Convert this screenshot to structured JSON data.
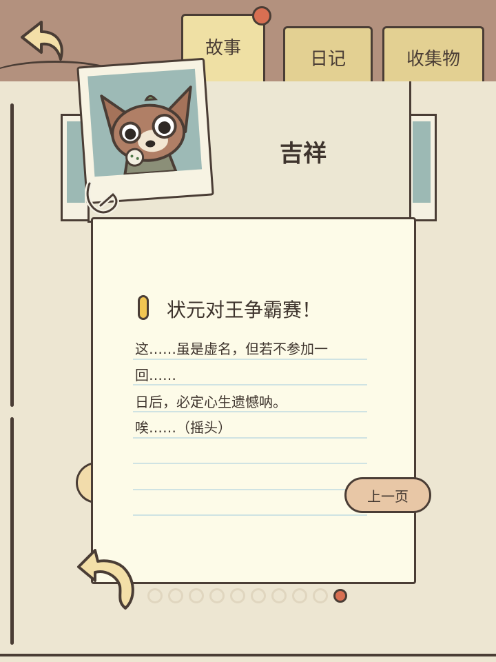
{
  "tabs": [
    {
      "label": "故事",
      "active": true
    },
    {
      "label": "日记",
      "active": false
    },
    {
      "label": "收集物",
      "active": false
    }
  ],
  "character": {
    "name": "吉祥"
  },
  "note": {
    "title": "状元对王争霸赛！",
    "lines": [
      "这……虽是虚名，但若不参加一",
      "回……",
      "日后，必定心生遗憾呐。",
      "唉……（摇头）"
    ]
  },
  "buttons": {
    "prev_label": "上一页"
  },
  "pagination": {
    "total": 10,
    "current": 10
  },
  "colors": {
    "background": "#b3917e",
    "paper": "#fdfbe8",
    "tab_active": "#efe0a4",
    "tab_inactive": "#e3d092",
    "accent_red": "#d86f52",
    "outline": "#4a3d35",
    "button": "#e8c7a6",
    "marker": "#f2c652"
  },
  "icons": [
    "back-arrow-icon",
    "paperclip-icon",
    "bird-icon",
    "pin-icon"
  ]
}
